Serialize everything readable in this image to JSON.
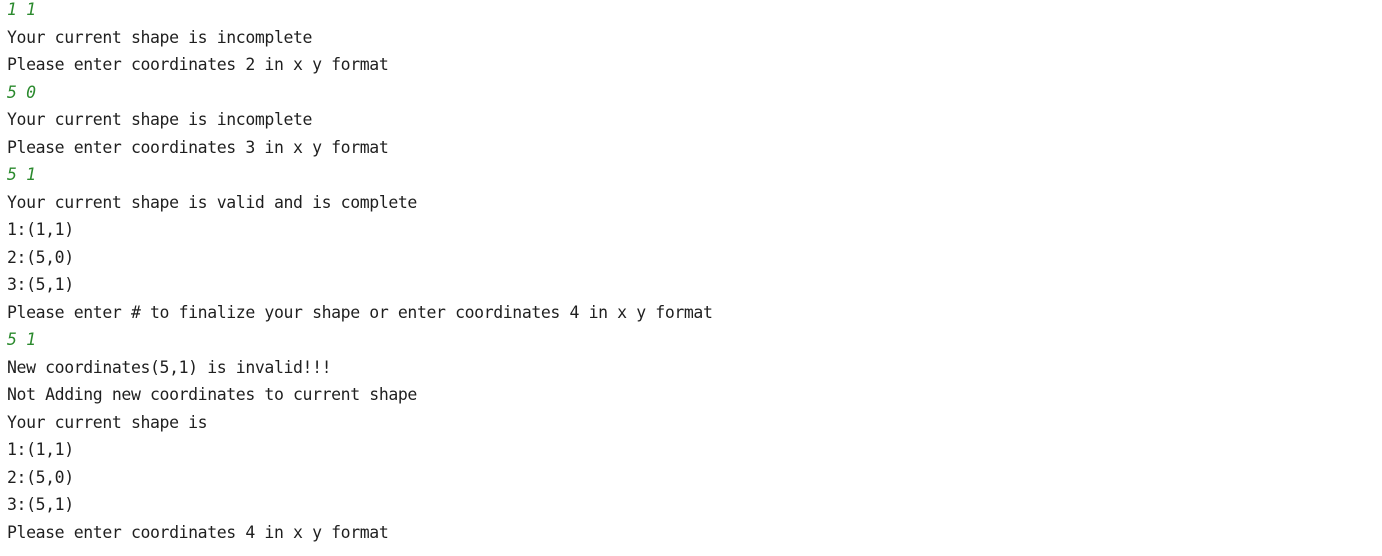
{
  "console": {
    "lines": [
      {
        "text": "1 1",
        "kind": "input"
      },
      {
        "text": "Your current shape is incomplete",
        "kind": "output"
      },
      {
        "text": "Please enter coordinates 2 in x y format",
        "kind": "output"
      },
      {
        "text": "5 0",
        "kind": "input"
      },
      {
        "text": "Your current shape is incomplete",
        "kind": "output"
      },
      {
        "text": "Please enter coordinates 3 in x y format",
        "kind": "output"
      },
      {
        "text": "5 1",
        "kind": "input"
      },
      {
        "text": "Your current shape is valid and is complete",
        "kind": "output"
      },
      {
        "text": "1:(1,1)",
        "kind": "output"
      },
      {
        "text": "2:(5,0)",
        "kind": "output"
      },
      {
        "text": "3:(5,1)",
        "kind": "output"
      },
      {
        "text": "Please enter # to finalize your shape or enter coordinates 4 in x y format",
        "kind": "output"
      },
      {
        "text": "5 1",
        "kind": "input"
      },
      {
        "text": "New coordinates(5,1) is invalid!!!",
        "kind": "output"
      },
      {
        "text": "Not Adding new coordinates to current shape",
        "kind": "output"
      },
      {
        "text": "Your current shape is",
        "kind": "output"
      },
      {
        "text": "1:(1,1)",
        "kind": "output"
      },
      {
        "text": "2:(5,0)",
        "kind": "output"
      },
      {
        "text": "3:(5,1)",
        "kind": "output"
      },
      {
        "text": "Please enter coordinates 4 in x y format",
        "kind": "output"
      }
    ],
    "colors": {
      "output": "#1f1f1f",
      "input": "#2b8a2e",
      "background": "#ffffff"
    }
  }
}
